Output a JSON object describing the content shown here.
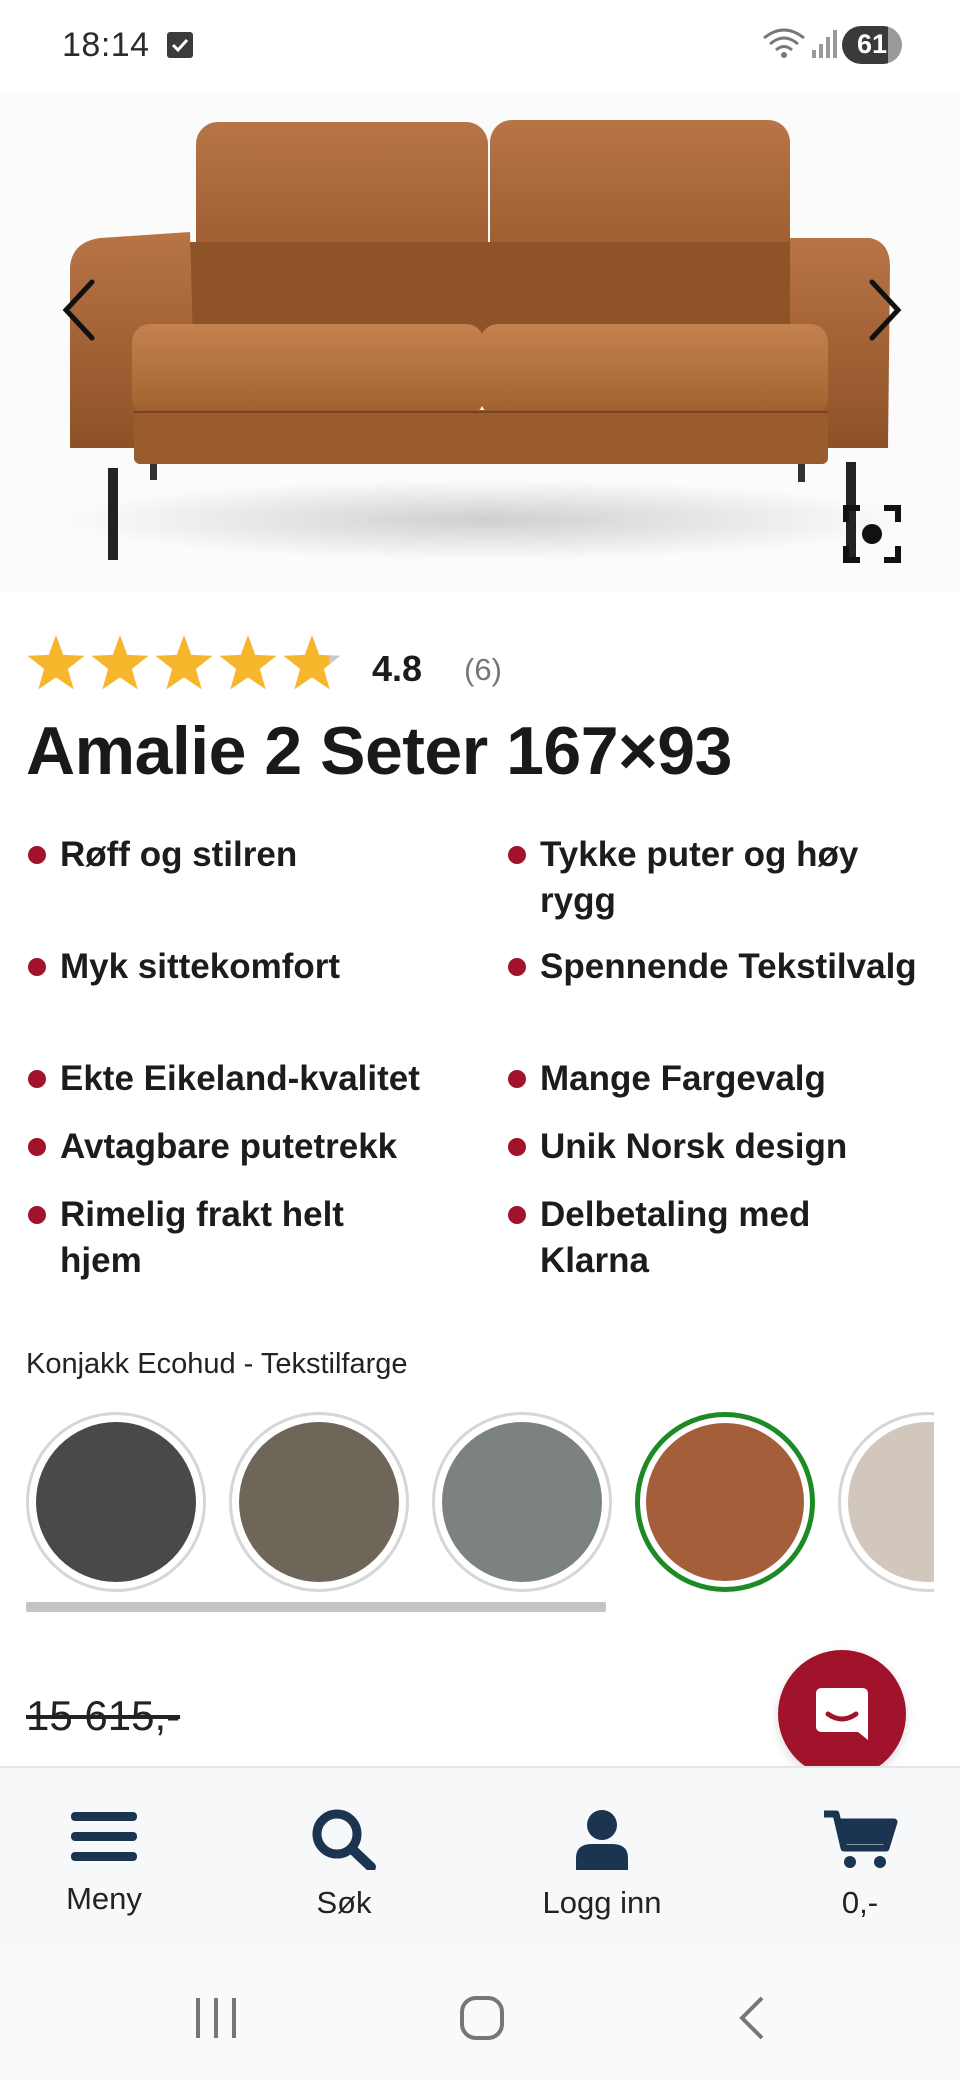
{
  "status_bar": {
    "time": "18:14",
    "battery": "61"
  },
  "product": {
    "rating": {
      "value": "4.8",
      "count": "(6)",
      "stars": 4.8,
      "max": 5
    },
    "title": "Amalie 2 Seter 167×93",
    "features": [
      "Røff og stilren",
      "Tykke puter og høy rygg",
      "Myk sittekomfort",
      "Spennende Tekstilvalg",
      "Ekte Eikeland-kvalitet",
      "Mange Fargevalg",
      "Avtagbare putetrekk",
      "Unik Norsk design",
      "Rimelig frakt helt hjem",
      "Delbetaling med Klarna"
    ],
    "color_label": "Konjakk Ecohud - Tekstilfarge",
    "swatches": [
      {
        "color": "#4a4848",
        "selected": false
      },
      {
        "color": "#6e6658",
        "selected": false
      },
      {
        "color": "#7c8280",
        "selected": false
      },
      {
        "color": "#a55e3a",
        "selected": true
      },
      {
        "color": "#d2c7bd",
        "selected": false
      }
    ],
    "old_price": "15 615,-"
  },
  "bottom_nav": {
    "menu": "Meny",
    "search": "Søk",
    "login": "Logg inn",
    "cart": "0,-"
  },
  "colors": {
    "accent": "#a0132a",
    "selected_ring": "#1d8a25",
    "star": "#f6b72d",
    "nav_icon": "#1b3550"
  }
}
